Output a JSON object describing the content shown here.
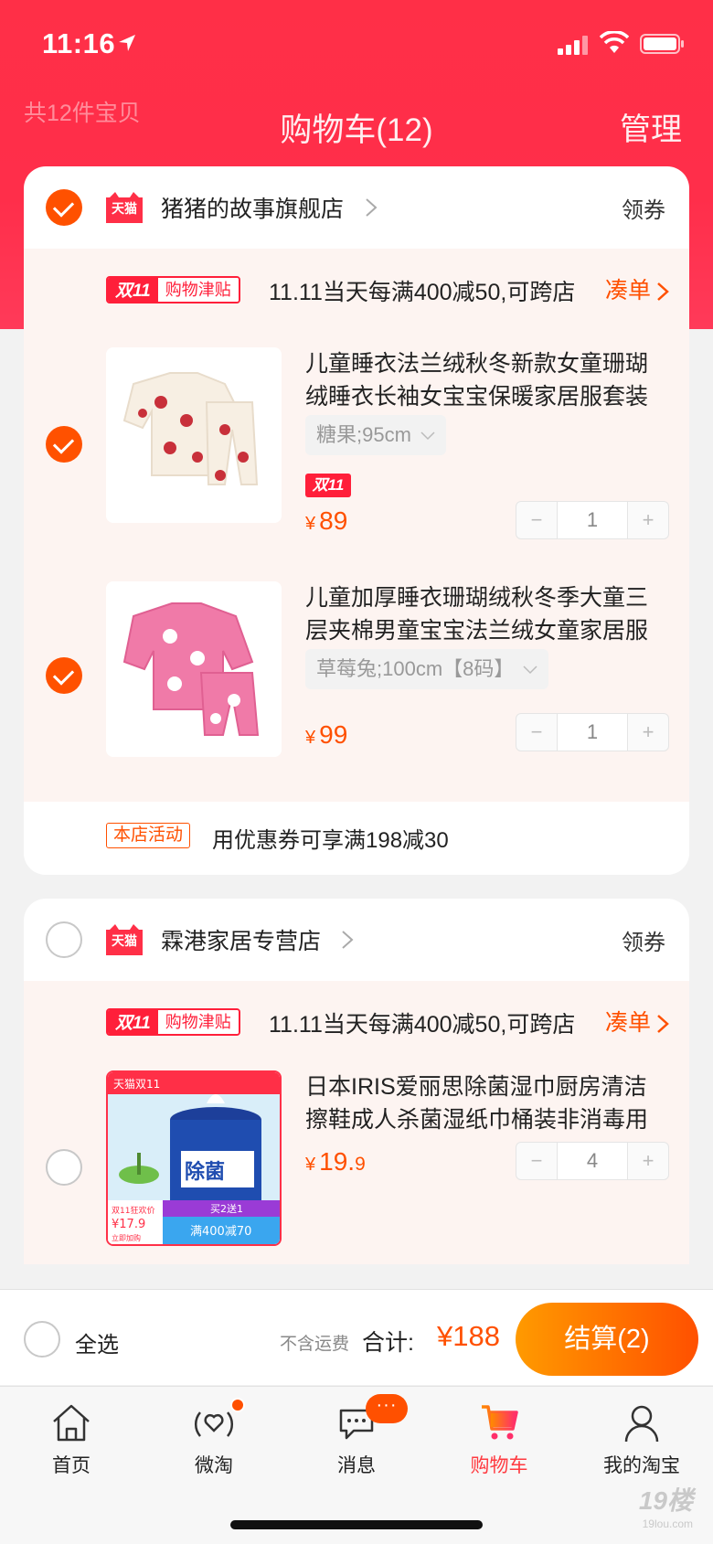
{
  "status_bar": {
    "time": "11:16"
  },
  "header": {
    "count_label": "共12件宝贝",
    "title": "购物车(12)",
    "manage": "管理"
  },
  "shops": [
    {
      "badge": "天猫",
      "name": "猪猪的故事旗舰店",
      "coupon": "领券",
      "selected": true,
      "promo": {
        "tag": "双11",
        "tag_sub": "购物津贴",
        "text": "11.11当天每满400减50,可跨店",
        "link": "凑单"
      },
      "items": [
        {
          "title": "儿童睡衣法兰绒秋冬新款女童珊瑚绒睡衣长袖女宝宝保暖家居服套装",
          "sku": "糖果;95cm",
          "badge": "双11",
          "currency": "¥",
          "price": "89",
          "price_decimal": "",
          "qty": "1",
          "minus": "−",
          "plus": "+"
        },
        {
          "title": "儿童加厚睡衣珊瑚绒秋冬季大童三层夹棉男童宝宝法兰绒女童家居服",
          "sku": "草莓兔;100cm【8码】",
          "currency": "¥",
          "price": "99",
          "price_decimal": "",
          "qty": "1",
          "minus": "−",
          "plus": "+"
        }
      ],
      "activity": {
        "tag": "本店活动",
        "text": "用优惠券可享满198减30"
      }
    },
    {
      "badge": "天猫",
      "name": "霖港家居专营店",
      "coupon": "领券",
      "selected": false,
      "promo": {
        "tag": "双11",
        "tag_sub": "购物津贴",
        "text": "11.11当天每满400减50,可跨店",
        "link": "凑单"
      },
      "items": [
        {
          "title": "日本IRIS爱丽思除菌湿巾厨房清洁擦鞋成人杀菌湿纸巾桶装非消毒用",
          "currency": "¥",
          "price": "19.",
          "price_decimal": "9",
          "qty": "4",
          "minus": "−",
          "plus": "+",
          "thumb_texts": {
            "top": "天猫双11",
            "promo": "双11狂欢价",
            "price": "¥17.9",
            "buy": "立即加购",
            "gift": "买2送1",
            "discount": "满400减70",
            "product": "除菌"
          }
        }
      ]
    }
  ],
  "footer": {
    "select_all": "全选",
    "no_shipping": "不含运费",
    "total_label": "合计:",
    "total": "¥188",
    "checkout": "结算(2)"
  },
  "tabbar": [
    {
      "label": "首页",
      "icon": "home-icon"
    },
    {
      "label": "微淘",
      "icon": "broadcast-heart-icon"
    },
    {
      "label": "消息",
      "icon": "chat-bubble-icon",
      "badge": "···"
    },
    {
      "label": "购物车",
      "icon": "cart-icon",
      "active": true
    },
    {
      "label": "我的淘宝",
      "icon": "person-icon"
    }
  ],
  "watermark": {
    "main": "19楼",
    "sub": "19lou.com"
  },
  "colors": {
    "brand_red": "#ff2f47",
    "price_orange": "#ff5000",
    "checkout_gradient": [
      "#ff9a00",
      "#ff5000"
    ]
  }
}
